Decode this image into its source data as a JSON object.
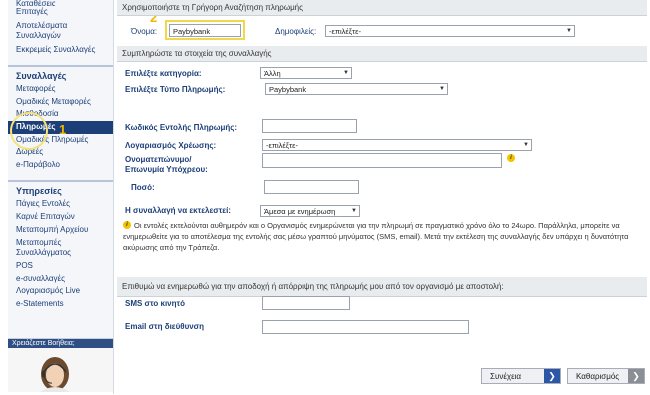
{
  "sidebar": {
    "top_items": [
      "Καταθέσεις",
      "Επιταγές",
      "Αποτελέσματα Συναλλαγών",
      "Εκκρεμείς Συναλλαγές"
    ],
    "section1_title": "Συναλλαγές",
    "section1_items": [
      "Μεταφορές",
      "Ομαδικές Μεταφορές",
      "Μισθοδοσία",
      "Πληρωμές",
      "Ομαδικές Πληρωμές",
      "Δωρεές",
      "e-Παράβολο"
    ],
    "section2_title": "Υπηρεσίες",
    "section2_items": [
      "Πάγιες Εντολές",
      "Καρνέ Επιταγών",
      "Μεταπομπή Αρχείου",
      "Μεταπομπές Συναλλάγματος",
      "POS",
      "e-συναλλαγές",
      "Λογαριασμός Live",
      "e-Statements"
    ],
    "help_title": "Χρειάζεστε Βοήθεια;"
  },
  "annotations": {
    "marker1": "1",
    "marker2": "2"
  },
  "quick_search": {
    "bar": "Χρησιμοποιήστε τη Γρήγορη Αναζήτηση πληρωμής",
    "name_label": "Όνομα:",
    "name_value": "Paybybank",
    "public_label": "Δημοφιλείς:",
    "public_value": "-επιλέξτε-"
  },
  "form": {
    "bar": "Συμπληρώστε τα στοιχεία της συναλλαγής",
    "category_label": "Επιλέξτε κατηγορία:",
    "category_value": "Άλλη",
    "type_label": "Επιλέξτε Τύπο Πληρωμής:",
    "type_value": "Paybybank",
    "code_label": "Κωδικός Εντολής Πληρωμής:",
    "debit_label": "Λογαριασμός Χρέωσης:",
    "debit_value": "-επιλέξτε-",
    "name_label_1": "Ονοματεπώνυμο/",
    "name_label_2": "Επωνυμία Υπόχρεου:",
    "amount_label": "Ποσό:",
    "exec_label": "Η συναλλαγή να εκτελεστεί:",
    "exec_value": "Άμεσα με ενημέρωση",
    "note": "Οι εντολές εκτελούνται αυθημερόν και ο Οργανισμός ενημερώνεται για την πληρωμή σε πραγματικό χρόνο όλο το 24ωρο. Παράλληλα, μπορείτε να ενημερωθείτε για το αποτέλεσμα της εντολής σας μέσω γραπτού μηνύματος (SMS, email). Μετά την εκτέλεση της συναλλαγής δεν υπάρχει η δυνατότητα ακύρωσης από την Τράπεζα."
  },
  "notify": {
    "bar": "Επιθυμώ να ενημερωθώ για την αποδοχή ή απόρριψη της πληρωμής μου από τον οργανισμό με αποστολή:",
    "sms_label": "SMS στο κινητό",
    "email_label": "Email στη διεύθυνση"
  },
  "buttons": {
    "continue": "Συνέχεια",
    "clear": "Καθαρισμός"
  },
  "colors": {
    "accent": "#1d3f78",
    "annotation": "#f0b800"
  }
}
